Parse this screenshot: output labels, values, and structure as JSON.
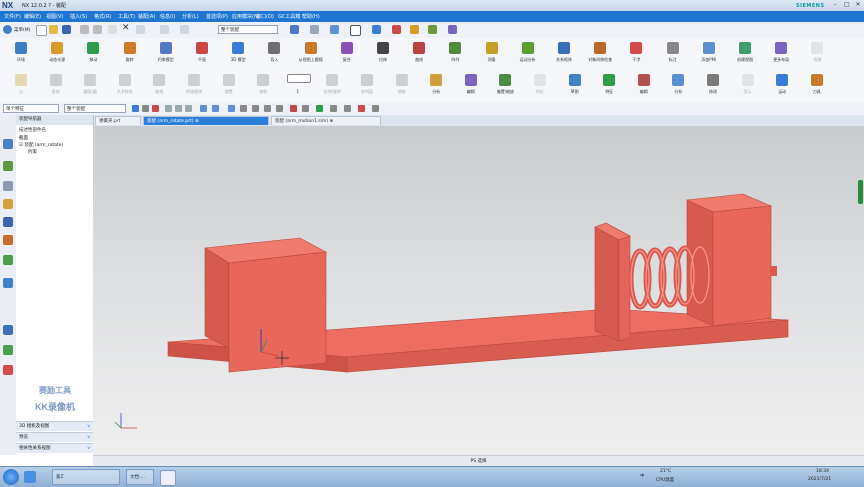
{
  "window": {
    "logo": "NX",
    "title": "NX 12.0.2 ?  - 装配",
    "brand": "SIEMENS",
    "controls": [
      "–",
      "□",
      "✕"
    ]
  },
  "menubar": {
    "items": [
      "文件(F)",
      "编辑(E)",
      "视图(V)",
      "插入(S)",
      "格式(R)",
      "工具(T)",
      "装配(A)",
      "信息(I)",
      "分析(L)",
      "首选项(P)",
      "应用模块(N)",
      "窗口(O)",
      "GC工具箱",
      "帮助(H)"
    ]
  },
  "qat": {
    "menu_label": "菜单(M)",
    "filter_combo": "整个装配",
    "fit_combo": "",
    "snap_combo": ""
  },
  "ribbon_row1": [
    {
      "label": "环境",
      "color": "#3e7fc4",
      "disabled": false
    },
    {
      "label": "动态光源",
      "color": "#d89a28",
      "disabled": false
    },
    {
      "label": "移动",
      "color": "#2f9b4f",
      "disabled": false
    },
    {
      "label": "旋转",
      "color": "#d27a2a",
      "disabled": false
    },
    {
      "label": "约束模型",
      "color": "#5577c8",
      "disabled": false
    },
    {
      "label": "平面",
      "color": "#c94848",
      "disabled": false
    },
    {
      "label": "3D 模型",
      "color": "#3a7bd5",
      "disabled": false
    },
    {
      "label": "导入",
      "color": "#6f6f6f",
      "disabled": false
    },
    {
      "label": "从视图上跟随",
      "color": "#c87a2a",
      "disabled": false
    },
    {
      "label": "复合",
      "color": "#8852b8",
      "disabled": false
    },
    {
      "label": "拉伸",
      "color": "#444444",
      "disabled": false
    },
    {
      "label": "曲线",
      "color": "#b84444",
      "disabled": false
    },
    {
      "label": "阵列",
      "color": "#4d8a3a",
      "disabled": false
    },
    {
      "label": "测量",
      "color": "#c2a12a",
      "disabled": false
    },
    {
      "label": "运动分析",
      "color": "#5f9f2f",
      "disabled": false
    },
    {
      "label": "关系矩阵",
      "color": "#3c6fb8",
      "disabled": false
    },
    {
      "label": "对象间隙检查",
      "color": "#b86a2a",
      "disabled": false
    },
    {
      "label": "干涉",
      "color": "#d04a4a",
      "disabled": false
    },
    {
      "label": "标注",
      "color": "#888888",
      "disabled": false
    },
    {
      "label": "添加PMI",
      "color": "#5a8fd0",
      "disabled": false
    },
    {
      "label": "创建视图",
      "color": "#3f9f6f",
      "disabled": false
    },
    {
      "label": "更多布局",
      "color": "#7a64c0",
      "disabled": false
    },
    {
      "label": "资源",
      "color": "#c0c0c0",
      "disabled": true
    }
  ],
  "ribbon_row2": [
    {
      "label": "点",
      "color": "#c9a33a",
      "disabled": true
    },
    {
      "label": "直线",
      "color": "#888888",
      "disabled": true
    },
    {
      "label": "圆弧/圆",
      "color": "#888888",
      "disabled": true
    },
    {
      "label": "艺术样条",
      "color": "#888888",
      "disabled": true
    },
    {
      "label": "曲线",
      "color": "#888888",
      "disabled": true
    },
    {
      "label": "桥接曲线",
      "color": "#888888",
      "disabled": true
    },
    {
      "label": "偏置",
      "color": "#888888",
      "disabled": true
    },
    {
      "label": "修剪",
      "color": "#888888",
      "disabled": true
    },
    {
      "label": "1",
      "color": "#ffffff",
      "disabled": false
    },
    {
      "label": "拉伸/旋转",
      "color": "#888888",
      "disabled": true
    },
    {
      "label": "阵列面",
      "color": "#888888",
      "disabled": true
    },
    {
      "label": "抽取",
      "color": "#888888",
      "disabled": true
    },
    {
      "label": "分析",
      "color": "#c9a33a",
      "disabled": false
    },
    {
      "label": "编辑",
      "color": "#7c62c0",
      "disabled": false
    },
    {
      "label": "偏置/缩放",
      "color": "#4c8a42",
      "disabled": false
    },
    {
      "label": "特征",
      "color": "#c0c0c0",
      "disabled": true
    },
    {
      "label": "草图",
      "color": "#3f83c6",
      "disabled": false
    },
    {
      "label": "特征",
      "color": "#2f9b4f",
      "disabled": false
    },
    {
      "label": "编辑",
      "color": "#b05050",
      "disabled": false
    },
    {
      "label": "分析",
      "color": "#5a8fd0",
      "disabled": false
    },
    {
      "label": "修改",
      "color": "#7a7a7a",
      "disabled": false
    },
    {
      "label": "显示",
      "color": "#c0c0c0",
      "disabled": true
    },
    {
      "label": "运动",
      "color": "#3a7bd5",
      "disabled": false
    },
    {
      "label": "刀具",
      "color": "#c87a2a",
      "disabled": false
    }
  ],
  "selectionbar": {
    "filter_combo": "单个特征",
    "scope_combo": "整个装配"
  },
  "tabs": [
    {
      "label": "弹簧夹.prt",
      "active": false
    },
    {
      "label": "装配 (arm_rotate.prt) ⊗",
      "active": true
    },
    {
      "label": "装配 (arm_motion1.sim) ⊗",
      "active": false
    }
  ],
  "navigator": {
    "title": "装配导航器",
    "column": "描述性部件名",
    "tree": [
      {
        "label": "截面",
        "level": 0
      },
      {
        "label": "☑ 装配 (arm_rotate)",
        "level": 0
      },
      {
        "label": "约束",
        "level": 1
      }
    ],
    "panels": [
      "3D 相机及视图",
      "预览",
      "相关性关系视图"
    ]
  },
  "watermark": {
    "line1": "赛励工具",
    "line2": "KK录像机"
  },
  "statusbar": {
    "text": "PS 选择"
  },
  "taskbar": {
    "apps": [
      "",
      "爱Z",
      "文档-...",
      ""
    ],
    "ime": "中",
    "weather": "21°C",
    "weather_sub": "CPU温度",
    "time": "18:34",
    "date": "2021/7/21"
  }
}
